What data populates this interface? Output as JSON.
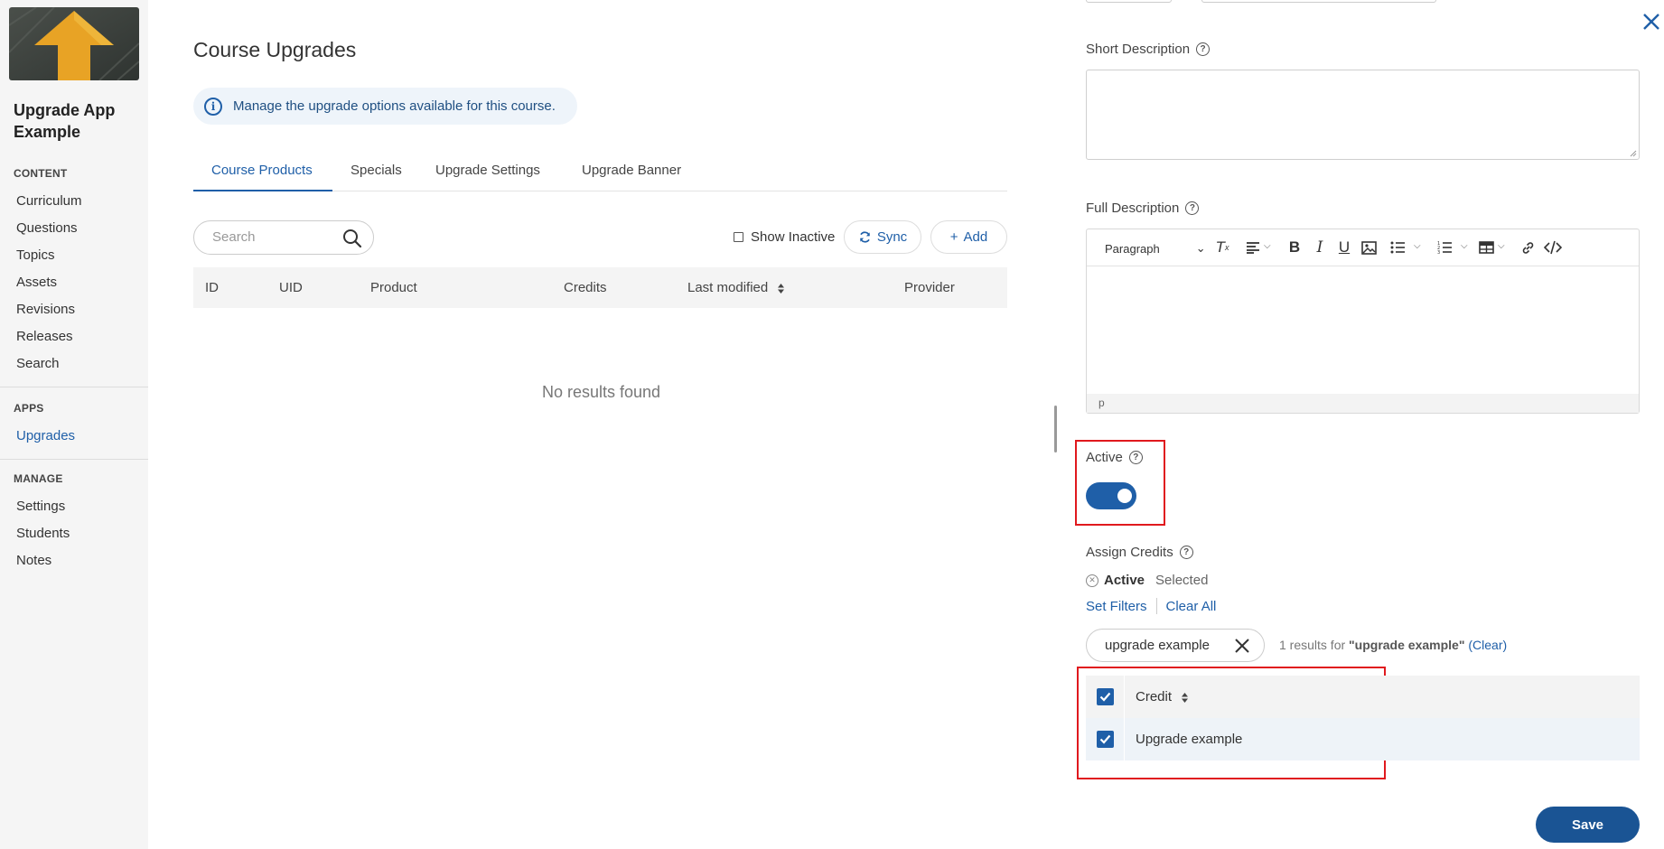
{
  "sidebar": {
    "app_title": "Upgrade App Example",
    "sections": [
      {
        "title": "CONTENT",
        "items": [
          "Curriculum",
          "Questions",
          "Topics",
          "Assets",
          "Revisions",
          "Releases",
          "Search"
        ]
      },
      {
        "title": "APPS",
        "items": [
          "Upgrades"
        ]
      },
      {
        "title": "MANAGE",
        "items": [
          "Settings",
          "Students",
          "Notes"
        ]
      }
    ],
    "active_item": "Upgrades"
  },
  "main": {
    "title": "Course Upgrades",
    "info_banner": "Manage the upgrade options available for this course.",
    "tabs": [
      "Course Products",
      "Specials",
      "Upgrade Settings",
      "Upgrade Banner"
    ],
    "active_tab": "Course Products",
    "search_placeholder": "Search",
    "show_inactive_label": "Show Inactive",
    "sync_label": "Sync",
    "add_label": "Add",
    "columns": [
      "ID",
      "UID",
      "Product",
      "Credits",
      "Last modified",
      "Provider"
    ],
    "empty_message": "No results found"
  },
  "panel": {
    "short_description_label": "Short Description",
    "full_description_label": "Full Description",
    "editor": {
      "block_format": "Paragraph",
      "status_path": "p"
    },
    "active_label": "Active",
    "active_on": true,
    "assign_credits_label": "Assign Credits",
    "filter_chip_name": "Active",
    "filter_chip_value": "Selected",
    "set_filters_label": "Set Filters",
    "clear_all_label": "Clear All",
    "search_value": "upgrade example",
    "results_prefix": "1 results for",
    "results_query": "\"upgrade example\"",
    "results_clear": "(Clear)",
    "credit_column": "Credit",
    "credits": [
      {
        "name": "Upgrade example",
        "checked": true
      }
    ],
    "save_label": "Save"
  },
  "colors": {
    "accent": "#1f5fa8",
    "save_button": "#1a5494",
    "highlight": "#e0191e"
  }
}
